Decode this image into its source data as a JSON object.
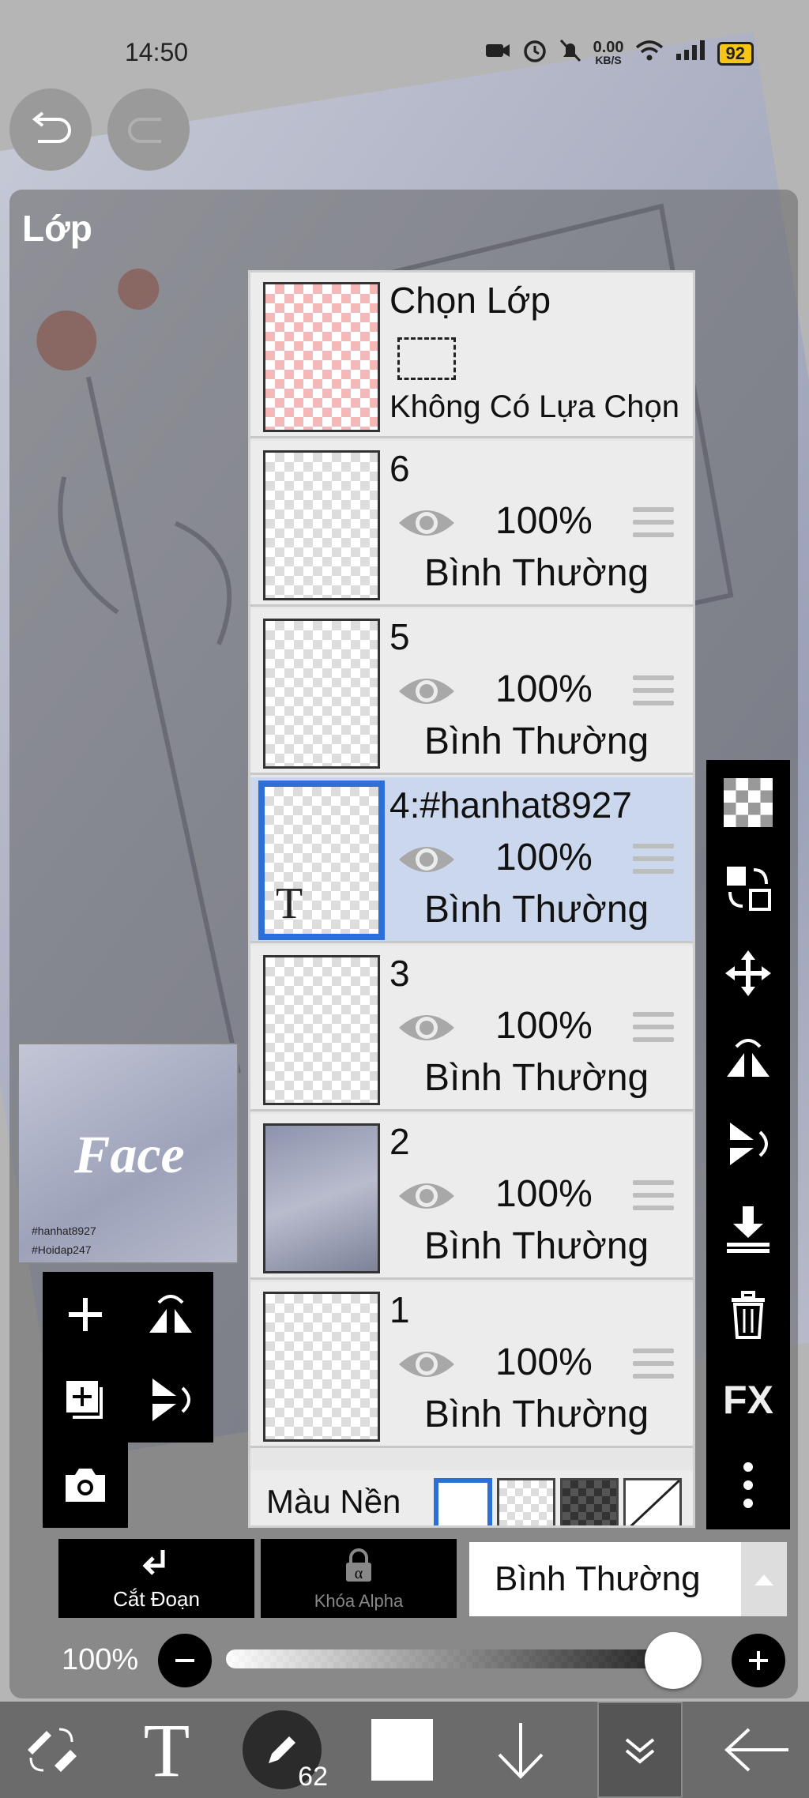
{
  "status_bar": {
    "time": "14:50",
    "net_speed_value": "0.00",
    "net_speed_unit": "KB/S",
    "battery": "92",
    "icons": [
      "video-icon",
      "alarm-icon",
      "mute-icon",
      "wifi-icon",
      "signal-icon",
      "battery-icon"
    ]
  },
  "panel": {
    "title": "Lớp"
  },
  "selection_layer": {
    "title": "Chọn Lớp",
    "subtitle": "Không Có Lựa Chọn"
  },
  "layers": [
    {
      "name": "6",
      "opacity": "100%",
      "blend": "Bình Thường",
      "selected": false
    },
    {
      "name": "5",
      "opacity": "100%",
      "blend": "Bình Thường",
      "selected": false
    },
    {
      "name": "4:#hanhat8927",
      "opacity": "100%",
      "blend": "Bình Thường",
      "selected": true,
      "thumb_icon": "T"
    },
    {
      "name": "3",
      "opacity": "100%",
      "blend": "Bình Thường",
      "selected": false
    },
    {
      "name": "2",
      "opacity": "100%",
      "blend": "Bình Thường",
      "selected": false
    },
    {
      "name": "1",
      "opacity": "100%",
      "blend": "Bình Thường",
      "selected": false
    }
  ],
  "background": {
    "label": "Màu Nền"
  },
  "preview": {
    "title_text": "Face",
    "tag1": "#hanhat8927",
    "tag2": "#Hoidap247"
  },
  "actions": {
    "clipping": "Cắt Đoạn",
    "alpha_lock": "Khóa Alpha",
    "blend_mode": "Bình Thường"
  },
  "opacity": {
    "label": "100%",
    "value": 1.0
  },
  "right_toolbar": {
    "fx": "FX",
    "items": [
      "transparency-icon",
      "replace-icon",
      "move-icon",
      "flip-horizontal-icon",
      "flip-vertical-icon",
      "merge-down-icon",
      "trash-icon",
      "fx-icon",
      "more-icon"
    ]
  },
  "bottom_toolbar": {
    "brush_size": "62",
    "text_tool": "T"
  },
  "colors": {
    "accent": "#2c6fd6",
    "selected_row": "#cbd7ec"
  }
}
